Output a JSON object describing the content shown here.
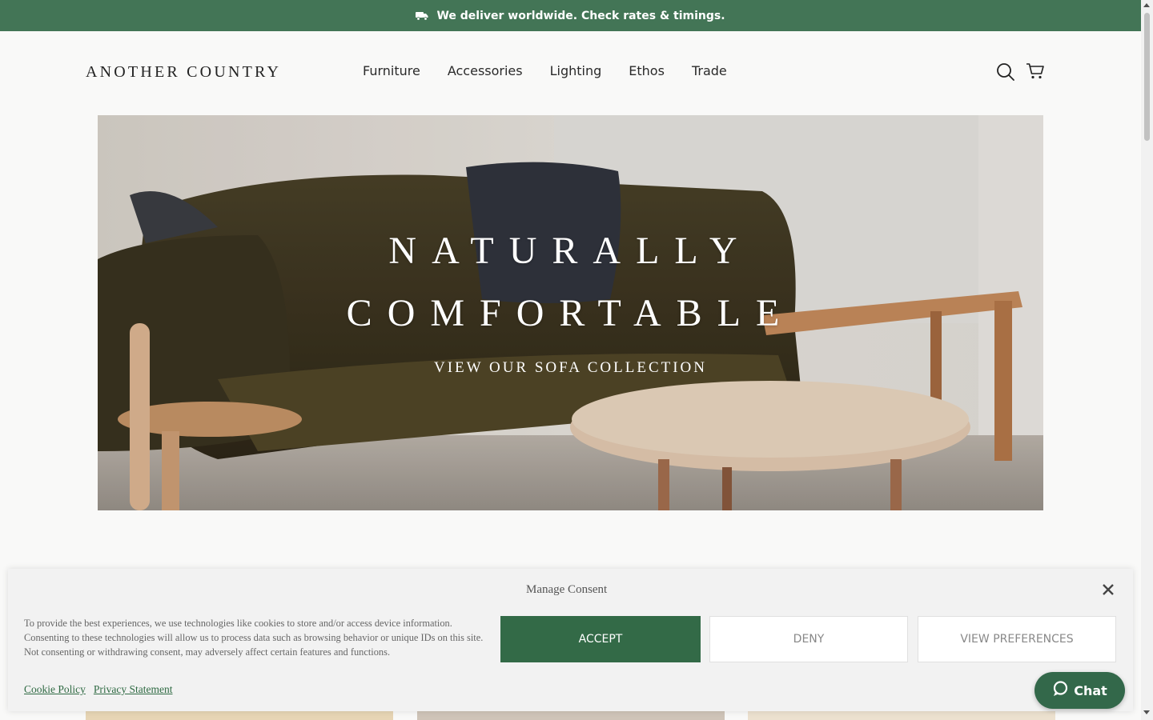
{
  "announcement": {
    "text": "We deliver worldwide. Check rates & timings."
  },
  "header": {
    "logo": "ANOTHER COUNTRY",
    "nav": [
      "Furniture",
      "Accessories",
      "Lighting",
      "Ethos",
      "Trade"
    ]
  },
  "hero": {
    "title_line1": "NATURALLY",
    "title_line2": "COMFORTABLE",
    "cta": "VIEW OUR SOFA COLLECTION"
  },
  "consent": {
    "title": "Manage Consent",
    "text": "To provide the best experiences, we use technologies like cookies to store and/or access device information. Consenting to these technologies will allow us to process data such as browsing behavior or unique IDs on this site. Not consenting or withdrawing consent, may adversely affect certain features and functions.",
    "accept": "ACCEPT",
    "deny": "DENY",
    "preferences": "VIEW PREFERENCES",
    "links": [
      "Cookie Policy",
      "Privacy Statement"
    ]
  },
  "chat": {
    "label": "Chat"
  },
  "colors": {
    "brand_green": "#437556",
    "accept_green": "#336a47"
  }
}
